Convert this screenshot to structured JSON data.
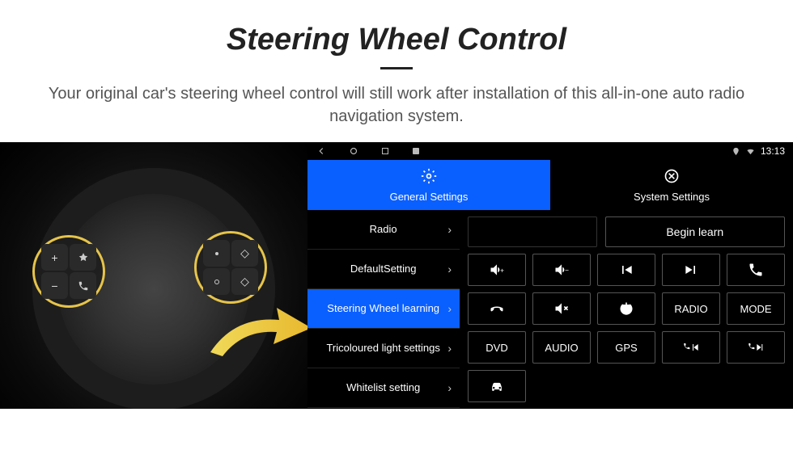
{
  "header": {
    "title": "Steering Wheel Control",
    "subtitle": "Your original car's steering wheel control will still work after installation of this all-in-one auto radio navigation system."
  },
  "statusbar": {
    "time": "13:13"
  },
  "tabs": {
    "general": "General Settings",
    "system": "System Settings"
  },
  "sidebar": {
    "items": [
      {
        "label": "Radio",
        "active": false
      },
      {
        "label": "DefaultSetting",
        "active": false
      },
      {
        "label": "Steering Wheel learning",
        "active": true
      },
      {
        "label": "Tricoloured light settings",
        "active": false
      },
      {
        "label": "Whitelist setting",
        "active": false
      }
    ]
  },
  "actions": {
    "begin": "Begin learn"
  },
  "buttons": {
    "row1": [
      "vol-up",
      "vol-down",
      "prev",
      "next",
      "call"
    ],
    "row2": [
      "hangup",
      "mute",
      "power",
      "RADIO",
      "MODE"
    ],
    "row3": [
      "DVD",
      "AUDIO",
      "GPS",
      "call-prev",
      "call-next"
    ],
    "row4": [
      "car",
      "",
      "",
      "",
      ""
    ]
  },
  "labels": {
    "RADIO": "RADIO",
    "MODE": "MODE",
    "DVD": "DVD",
    "AUDIO": "AUDIO",
    "GPS": "GPS"
  }
}
